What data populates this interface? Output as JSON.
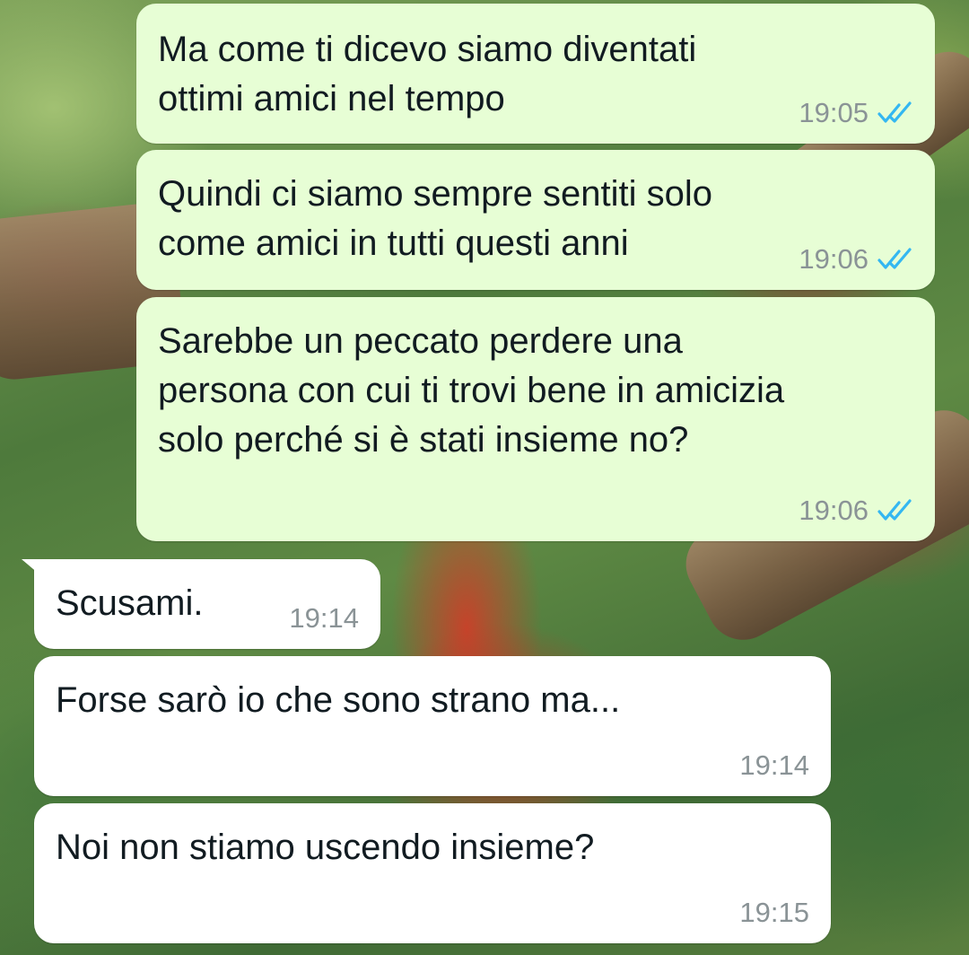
{
  "messages": [
    {
      "direction": "outgoing",
      "text": "Ma come ti dicevo siamo diventati\nottimi amici nel tempo",
      "time": "19:05",
      "status": "read-double-check-icon"
    },
    {
      "direction": "outgoing",
      "text": "Quindi ci siamo sempre sentiti solo\ncome amici in tutti questi anni",
      "time": "19:06",
      "status": "read-double-check-icon"
    },
    {
      "direction": "outgoing",
      "text": "Sarebbe un peccato perdere una\npersona con cui ti trovi bene in amicizia\nsolo perché si è stati insieme no?",
      "time": "19:06",
      "status": "read-double-check-icon"
    },
    {
      "direction": "incoming",
      "text": "Scusami.",
      "time": "19:14"
    },
    {
      "direction": "incoming",
      "text": "Forse sarò io che sono strano ma...",
      "time": "19:14"
    },
    {
      "direction": "incoming",
      "text": "Noi non stiamo uscendo insieme?",
      "time": "19:15"
    }
  ],
  "colors": {
    "outgoing_bubble": "#e7fed5",
    "incoming_bubble": "#ffffff",
    "read_tick": "#34b7f1",
    "timestamp": "#8a9396"
  }
}
